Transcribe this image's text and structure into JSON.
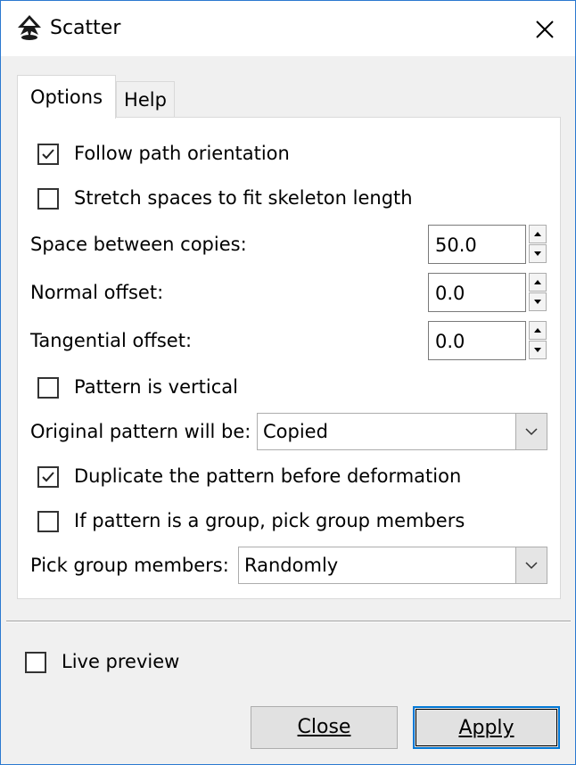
{
  "window": {
    "title": "Scatter"
  },
  "tabs": [
    {
      "label": "Options"
    },
    {
      "label": "Help"
    }
  ],
  "options": {
    "follow_path": {
      "label": "Follow path orientation",
      "checked": true
    },
    "stretch": {
      "label": "Stretch spaces to fit skeleton length",
      "checked": false
    },
    "space_between": {
      "label": "Space between copies:",
      "value": "50.0"
    },
    "normal_offset": {
      "label": "Normal offset:",
      "value": "0.0"
    },
    "tangential_offset": {
      "label": "Tangential offset:",
      "value": "0.0"
    },
    "vertical": {
      "label": "Pattern is vertical",
      "checked": false
    },
    "original_pattern": {
      "label": "Original pattern will be:",
      "value": "Copied"
    },
    "duplicate": {
      "label": "Duplicate the pattern before deformation",
      "checked": true
    },
    "group_members_chk": {
      "label": "If pattern is a group, pick group members",
      "checked": false
    },
    "pick_group": {
      "label": "Pick group members:",
      "value": "Randomly"
    }
  },
  "live_preview": {
    "label": "Live preview",
    "checked": false
  },
  "buttons": {
    "close": "Close",
    "apply": "Apply"
  }
}
